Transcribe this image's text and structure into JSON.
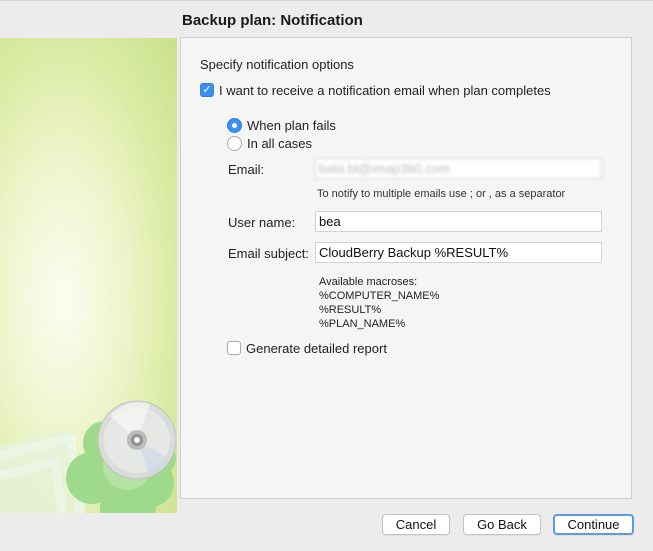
{
  "window": {
    "title": "Backup plan: Notification"
  },
  "content": {
    "section_title": "Specify notification options",
    "notify_checkbox": {
      "label": "I want to receive a notification email when plan completes",
      "checked": true
    },
    "radio_options": [
      {
        "label": "When plan fails",
        "selected": true
      },
      {
        "label": "In all cases",
        "selected": false
      }
    ],
    "email": {
      "label": "Email:",
      "value": "bata.bt@imap360.com"
    },
    "email_hint": "To notify to multiple emails use ; or , as a separator",
    "username": {
      "label": "User name:",
      "value": "bea"
    },
    "subject": {
      "label": "Email subject:",
      "value": "CloudBerry Backup %RESULT%"
    },
    "macros": {
      "title": "Available macroses:",
      "items": [
        "%COMPUTER_NAME%",
        "%RESULT%",
        "%PLAN_NAME%"
      ]
    },
    "report_checkbox": {
      "label": "Generate detailed report",
      "checked": false
    }
  },
  "buttons": {
    "cancel": "Cancel",
    "back": "Go Back",
    "continue": "Continue"
  },
  "colors": {
    "accent": "#3b8ff2",
    "window_bg": "#ececec",
    "panel_bg": "#f5f5f5",
    "art_green": "#9fd98c"
  },
  "icons": {
    "notify_checkbox": "checkmark-icon",
    "artwork": "cd-disc-icon"
  }
}
